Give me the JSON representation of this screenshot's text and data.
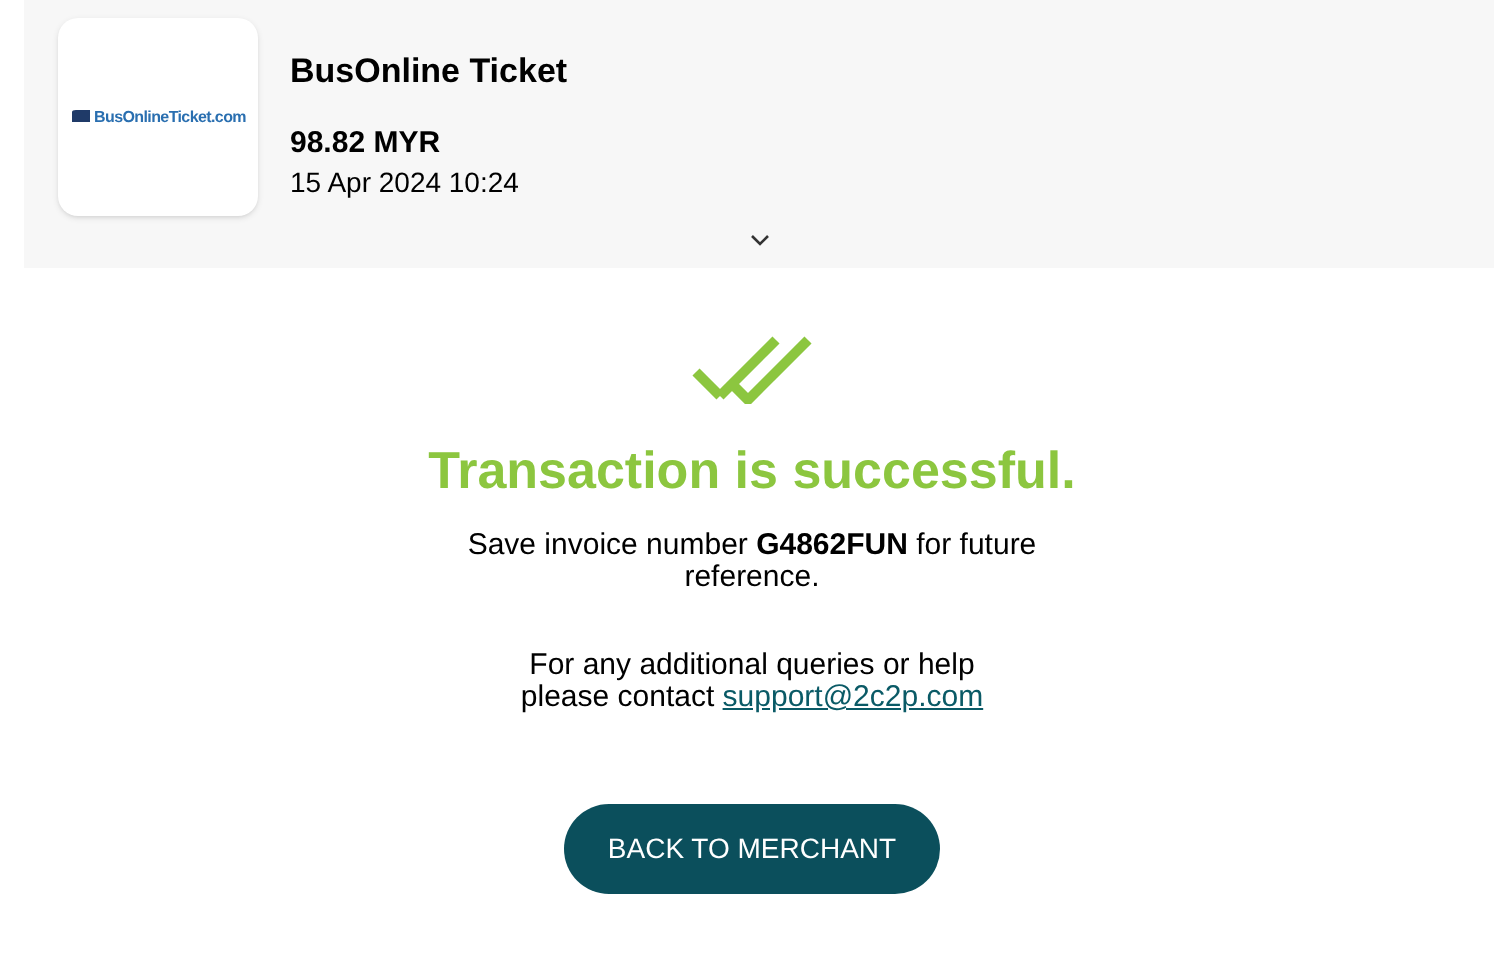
{
  "merchant": {
    "logo_text": "BusOnlineTicket.com",
    "name": "BusOnline Ticket",
    "amount": "98.82 MYR",
    "datetime": "15 Apr 2024 10:24",
    "expanded": false
  },
  "result": {
    "title": "Transaction is successful.",
    "invoice_message": "Save invoice number **G4862FUN** for future reference.",
    "contact_line_1": "For any additional queries or help",
    "contact_line_2": "please contact",
    "contact_email": "support@2c2p.com"
  },
  "button": "BACK TO MERCHANT"
}
